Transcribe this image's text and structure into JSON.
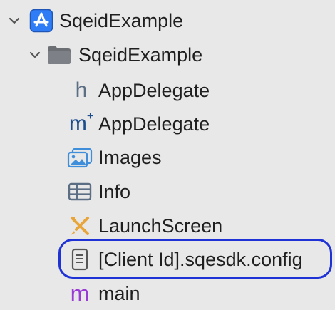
{
  "navigator": {
    "items": [
      {
        "label": "SqeidExample",
        "icon": "app-store-icon",
        "kind": "project"
      },
      {
        "label": "SqeidExample",
        "icon": "folder-icon",
        "kind": "group"
      },
      {
        "label": "AppDelegate",
        "icon": "header-file-icon",
        "icon_text": "h",
        "icon_color": "#5b6e84"
      },
      {
        "label": "AppDelegate",
        "icon": "objc-implementation-file-icon",
        "icon_text": "m",
        "icon_sup": "+",
        "icon_color": "#1c4d8c"
      },
      {
        "label": "Images",
        "icon": "asset-catalog-icon"
      },
      {
        "label": "Info",
        "icon": "plist-table-icon"
      },
      {
        "label": "LaunchScreen",
        "icon": "interface-builder-icon"
      },
      {
        "label": "[Client Id].sqesdk.config",
        "icon": "document-icon",
        "highlighted": true
      },
      {
        "label": "main",
        "icon": "objc-source-file-icon",
        "icon_text": "m",
        "icon_color": "#9a3bd6"
      }
    ]
  },
  "colors": {
    "highlight": "#1e32d6",
    "background": "#e8e8e8",
    "text": "#1f1f1f"
  }
}
